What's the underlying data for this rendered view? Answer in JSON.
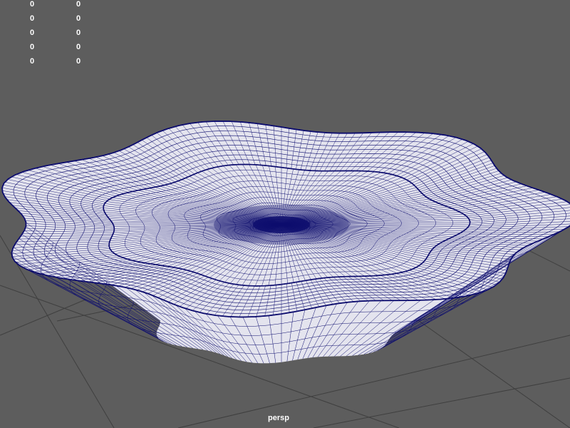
{
  "viewport": {
    "camera_name": "persp",
    "background_color": "#5d5d5d",
    "grid_color": "#3f3f3f",
    "wire_color": "#0d0d6e",
    "surface_color": "#e4e4ee"
  },
  "hud": {
    "left_column": [
      "0",
      "0",
      "0",
      "0",
      "0"
    ],
    "right_column": [
      "0",
      "0",
      "0",
      "0",
      "0"
    ]
  },
  "model": {
    "name": "wireframe-scalloped-dish"
  }
}
